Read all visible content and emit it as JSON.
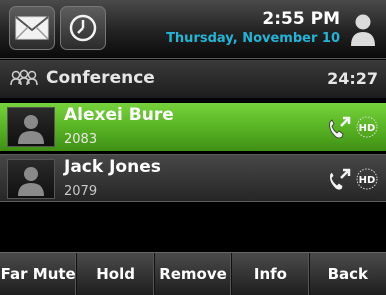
{
  "status_bar": {
    "time": "2:55 PM",
    "date": "Thursday, November 10",
    "date_color": "#23b4d6",
    "icons": [
      "mail-icon",
      "clock-icon",
      "user-icon"
    ]
  },
  "conference": {
    "title": "Conference",
    "timer": "24:27"
  },
  "participants": [
    {
      "name": "Alexei Bure",
      "number": "2083",
      "state": "active",
      "highlight_color": "#5cbf2a"
    },
    {
      "name": "Jack Jones",
      "number": "2079",
      "state": "inactive"
    }
  ],
  "softkeys": [
    "Far Mute",
    "Hold",
    "Remove",
    "Info",
    "Back"
  ]
}
